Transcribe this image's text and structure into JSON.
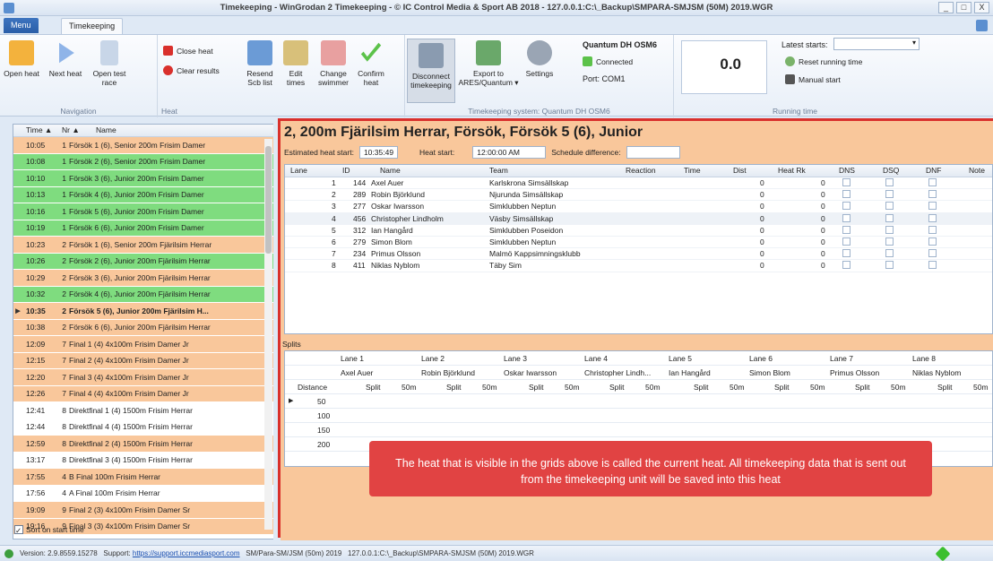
{
  "window": {
    "title": "Timekeeping - WinGrodan 2 Timekeeping - © IC Control Media & Sport AB 2018 - 127.0.0.1:C:\\_Backup\\SMPARA-SMJSM (50M) 2019.WGR",
    "controls": [
      "_",
      "□",
      "X"
    ]
  },
  "tabs": {
    "menu": "Menu",
    "timekeeping": "Timekeeping"
  },
  "ribbon": {
    "navigation": {
      "label": "Navigation",
      "buttons": [
        {
          "label": "Open heat",
          "icon": "folder-icon"
        },
        {
          "label": "Next heat",
          "icon": "play-icon"
        },
        {
          "label": "Open test race",
          "icon": "document-icon"
        }
      ]
    },
    "heat": {
      "label": "Heat",
      "small": [
        {
          "label": "Close heat",
          "icon": "close-icon"
        },
        {
          "label": "Clear results",
          "icon": "clear-icon"
        }
      ],
      "buttons": [
        {
          "label": "Resend Scb list",
          "icon": "refresh-icon"
        },
        {
          "label": "Edit times",
          "icon": "pencil-icon"
        },
        {
          "label": "Change swimmer",
          "icon": "swimmer-icon"
        },
        {
          "label": "Confirm heat",
          "icon": "checkmark-icon"
        }
      ]
    },
    "system": {
      "label": "Timekeeping system: Quantum DH OSM6",
      "buttons": [
        {
          "label": "Disconnect timekeeping",
          "icon": "disconnect-icon"
        },
        {
          "label": "Export to ARES/Quantum ▾",
          "icon": "export-icon"
        },
        {
          "label": "Settings",
          "icon": "gear-icon"
        }
      ],
      "device_name": "Quantum DH OSM6",
      "connected": "Connected",
      "port": "Port: COM1"
    },
    "running": {
      "label": "Running time",
      "value": "0.0",
      "latest_starts_label": "Latest starts:",
      "reset": "Reset running time",
      "manual": "Manual start"
    }
  },
  "heat_list": {
    "headers": {
      "time": "Time ▲",
      "nr": "Nr ▲",
      "name": "Name"
    },
    "rows": [
      {
        "time": "10:05",
        "nr": "1",
        "name": "Försök 1 (6), Senior 200m Frisim Damer",
        "color": "#f9c79b"
      },
      {
        "time": "10:08",
        "nr": "1",
        "name": "Försök 2 (6), Senior 200m Frisim Damer",
        "color": "#7fdc7f"
      },
      {
        "time": "10:10",
        "nr": "1",
        "name": "Försök 3 (6), Junior 200m Frisim Damer",
        "color": "#7fdc7f"
      },
      {
        "time": "10:13",
        "nr": "1",
        "name": "Försök 4 (6), Junior 200m Frisim Damer",
        "color": "#7fdc7f"
      },
      {
        "time": "10:16",
        "nr": "1",
        "name": "Försök 5 (6), Junior 200m Frisim Damer",
        "color": "#7fdc7f"
      },
      {
        "time": "10:19",
        "nr": "1",
        "name": "Försök 6 (6), Junior 200m Frisim Damer",
        "color": "#7fdc7f"
      },
      {
        "time": "10:23",
        "nr": "2",
        "name": "Försök 1 (6), Senior 200m Fjärilsim Herrar",
        "color": "#f9c79b"
      },
      {
        "time": "10:26",
        "nr": "2",
        "name": "Försök 2 (6), Junior 200m Fjärilsim Herrar",
        "color": "#7fdc7f"
      },
      {
        "time": "10:29",
        "nr": "2",
        "name": "Försök 3 (6), Junior 200m Fjärilsim Herrar",
        "color": "#f9c79b"
      },
      {
        "time": "10:32",
        "nr": "2",
        "name": "Försök 4 (6), Junior 200m Fjärilsim Herrar",
        "color": "#7fdc7f"
      },
      {
        "time": "10:35",
        "nr": "2",
        "name": "Försök 5 (6), Junior 200m Fjärilsim H...",
        "color": "#f9c79b",
        "current": true
      },
      {
        "time": "10:38",
        "nr": "2",
        "name": "Försök 6 (6), Junior 200m Fjärilsim Herrar",
        "color": "#f9c79b"
      },
      {
        "time": "12:09",
        "nr": "7",
        "name": "Final 1 (4) 4x100m Frisim Damer Jr",
        "color": "#f9c79b"
      },
      {
        "time": "12:15",
        "nr": "7",
        "name": "Final 2 (4) 4x100m Frisim Damer Jr",
        "color": "#f9c79b"
      },
      {
        "time": "12:20",
        "nr": "7",
        "name": "Final 3 (4) 4x100m Frisim Damer Jr",
        "color": "#f9c79b"
      },
      {
        "time": "12:26",
        "nr": "7",
        "name": "Final 4 (4) 4x100m Frisim Damer Jr",
        "color": "#f9c79b"
      },
      {
        "time": "12:41",
        "nr": "8",
        "name": "Direktfinal 1 (4) 1500m Frisim Herrar",
        "color": "#ffffff"
      },
      {
        "time": "12:44",
        "nr": "8",
        "name": "Direktfinal 4 (4) 1500m Frisim Herrar",
        "color": "#ffffff"
      },
      {
        "time": "12:59",
        "nr": "8",
        "name": "Direktfinal 2 (4) 1500m Frisim Herrar",
        "color": "#f9c79b"
      },
      {
        "time": "13:17",
        "nr": "8",
        "name": "Direktfinal 3 (4) 1500m Frisim Herrar",
        "color": "#ffffff"
      },
      {
        "time": "17:55",
        "nr": "4",
        "name": "B Final 100m Frisim Herrar",
        "color": "#f9c79b"
      },
      {
        "time": "17:56",
        "nr": "4",
        "name": "A Final 100m Frisim Herrar",
        "color": "#ffffff"
      },
      {
        "time": "19:09",
        "nr": "9",
        "name": "Final 2 (3) 4x100m Frisim Damer Sr",
        "color": "#f9c79b"
      },
      {
        "time": "19:16",
        "nr": "9",
        "name": "Final 3 (3) 4x100m Frisim Damer Sr",
        "color": "#f9c79b"
      }
    ],
    "sort_label": "Sort on start time"
  },
  "heat": {
    "title": "2, 200m Fjärilsim Herrar, Försök, Försök 5 (6), Junior",
    "est_label": "Estimated heat start:",
    "est_value": "10:35:49",
    "start_label": "Heat start:",
    "start_value": "12:00:00 AM",
    "sched_label": "Schedule difference:",
    "columns": [
      "Lane",
      "ID",
      "Name",
      "Team",
      "Reaction",
      "Time",
      "Dist",
      "Heat Rk",
      "DNS",
      "DSQ",
      "DNF",
      "Note"
    ],
    "rows": [
      {
        "lane": "1",
        "id": "144",
        "name": "Axel Auer",
        "team": "Karlskrona Simsällskap",
        "dist": "0",
        "rk": "0"
      },
      {
        "lane": "2",
        "id": "289",
        "name": "Robin Björklund",
        "team": "Njurunda Simsällskap",
        "dist": "0",
        "rk": "0"
      },
      {
        "lane": "3",
        "id": "277",
        "name": "Oskar Iwarsson",
        "team": "Simklubben Neptun",
        "dist": "0",
        "rk": "0"
      },
      {
        "lane": "4",
        "id": "456",
        "name": "Christopher Lindholm",
        "team": "Väsby Simsällskap",
        "dist": "0",
        "rk": "0"
      },
      {
        "lane": "5",
        "id": "312",
        "name": "Ian Hangård",
        "team": "Simklubben Poseidon",
        "dist": "0",
        "rk": "0"
      },
      {
        "lane": "6",
        "id": "279",
        "name": "Simon Blom",
        "team": "Simklubben Neptun",
        "dist": "0",
        "rk": "0"
      },
      {
        "lane": "7",
        "id": "234",
        "name": "Primus Olsson",
        "team": "Malmö Kappsimningsklubb",
        "dist": "0",
        "rk": "0"
      },
      {
        "lane": "8",
        "id": "411",
        "name": "Niklas Nyblom",
        "team": "Täby Sim",
        "dist": "0",
        "rk": "0"
      }
    ]
  },
  "splits": {
    "title": "Splits",
    "lanes": [
      "Lane 1",
      "Lane 2",
      "Lane 3",
      "Lane 4",
      "Lane 5",
      "Lane 6",
      "Lane 7",
      "Lane 8"
    ],
    "swimmers": [
      "Axel Auer",
      "Robin Björklund",
      "Oskar Iwarsson",
      "Christopher Lindh...",
      "Ian Hangård",
      "Simon Blom",
      "Primus Olsson",
      "Niklas Nyblom"
    ],
    "distance_label": "Distance",
    "split_label": "Split",
    "m_label": "50m",
    "distances": [
      "50",
      "100",
      "150",
      "200"
    ]
  },
  "tooltip": "The heat that is visible in the grids above is called the current heat. All timekeeping data that is sent out from the timekeeping unit will be saved into this heat",
  "status": {
    "version": "Version: 2.9.8559.15278",
    "support_label": "Support:",
    "support_link": "https://support.iccmediasport.com",
    "meet": "SM/Para-SM/JSM (50m) 2019",
    "path": "127.0.0.1:C:\\_Backup\\SMPARA-SMJSM (50M) 2019.WGR"
  }
}
